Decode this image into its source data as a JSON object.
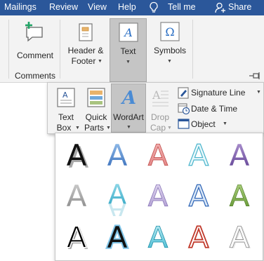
{
  "tabs": [
    {
      "label": "Mailings"
    },
    {
      "label": "Review"
    },
    {
      "label": "View"
    },
    {
      "label": "Help"
    }
  ],
  "tell_me": "Tell me",
  "share": "Share",
  "ribbon": {
    "comment_label": "Comment",
    "comments_group": "Comments",
    "header_footer": [
      "Header &",
      "Footer"
    ],
    "text_label": "Text",
    "symbols_label": "Symbols"
  },
  "text_panel": {
    "text_box": [
      "Text",
      "Box"
    ],
    "quick_parts": [
      "Quick",
      "Parts"
    ],
    "wordart": "WordArt",
    "drop_cap": [
      "Drop",
      "Cap"
    ],
    "signature_line": "Signature Line",
    "date_time": "Date & Time",
    "object": "Object"
  },
  "wordart_gallery": {
    "glyph": "A",
    "styles": [
      "black-shadow",
      "blue-gradient",
      "red-outline",
      "cyan-outline",
      "purple-gradient",
      "gray-gradient",
      "teal-reflection",
      "lavender-bevel",
      "blue-outline",
      "green-bevel",
      "black-white-outline",
      "black-blue-glow",
      "cyan-bevel",
      "red-white-outline",
      "white-gray-outline"
    ]
  },
  "colors": {
    "accent": "#2b579a",
    "selected": "#c5c5c5"
  }
}
